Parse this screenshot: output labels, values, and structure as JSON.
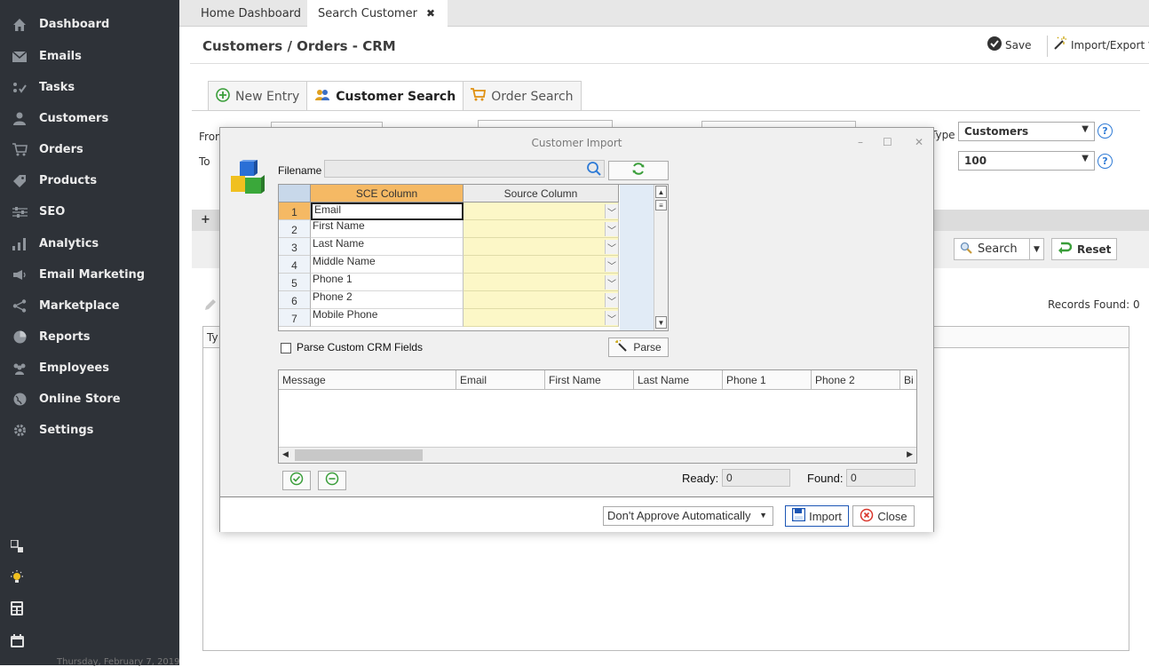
{
  "sidebar": {
    "items": [
      {
        "label": "Dashboard",
        "icon": "home-icon"
      },
      {
        "label": "Emails",
        "icon": "envelope-icon"
      },
      {
        "label": "Tasks",
        "icon": "tasks-icon"
      },
      {
        "label": "Customers",
        "icon": "user-icon"
      },
      {
        "label": "Orders",
        "icon": "cart-icon"
      },
      {
        "label": "Products",
        "icon": "tag-icon"
      },
      {
        "label": "SEO",
        "icon": "sliders-icon"
      },
      {
        "label": "Analytics",
        "icon": "bar-chart-icon"
      },
      {
        "label": "Email Marketing",
        "icon": "megaphone-icon"
      },
      {
        "label": "Marketplace",
        "icon": "share-icon"
      },
      {
        "label": "Reports",
        "icon": "pie-icon"
      },
      {
        "label": "Employees",
        "icon": "people-icon"
      },
      {
        "label": "Online Store",
        "icon": "globe-icon"
      },
      {
        "label": "Settings",
        "icon": "gear-icon"
      }
    ],
    "footer_date": "Thursday, February 7, 2019"
  },
  "tabs": {
    "home": "Home Dashboard",
    "search_customer": "Search Customer",
    "close_glyph": "✖"
  },
  "header": {
    "title": "Customers / Orders - CRM",
    "save": "Save",
    "import_export": "Import/Export"
  },
  "subtabs": {
    "new_entry": "New Entry",
    "customer_search": "Customer Search",
    "order_search": "Order Search"
  },
  "form": {
    "from_label": "From",
    "to_label": "To",
    "type_label": "Type",
    "type_value": "Customers",
    "limit_value": "100",
    "add_label": "+"
  },
  "toolbar": {
    "search": "Search",
    "reset": "Reset",
    "records_found": "Records Found: 0",
    "results_col_type": "Ty"
  },
  "modal": {
    "title": "Customer Import",
    "filename_label": "Filename",
    "grid_headers": {
      "sce": "SCE Column",
      "source": "Source Column"
    },
    "rows": [
      {
        "num": "1",
        "name": "Email"
      },
      {
        "num": "2",
        "name": "First Name"
      },
      {
        "num": "3",
        "name": "Last Name"
      },
      {
        "num": "4",
        "name": "Middle Name"
      },
      {
        "num": "5",
        "name": "Phone 1"
      },
      {
        "num": "6",
        "name": "Phone 2"
      },
      {
        "num": "7",
        "name": "Mobile Phone"
      }
    ],
    "parse_custom": "Parse Custom CRM Fields",
    "parse_button": "Parse",
    "log_headers": [
      "Message",
      "Email",
      "First Name",
      "Last Name",
      "Phone 1",
      "Phone 2",
      "Bi"
    ],
    "ready_label": "Ready:",
    "ready_value": "0",
    "found_label": "Found:",
    "found_value": "0",
    "approve_option": "Don't Approve Automatically",
    "import_button": "Import",
    "close_button": "Close"
  },
  "colors": {
    "sidebar_bg": "#2e3238",
    "grid_header": "#f5b964",
    "source_cell": "#fcf7c7",
    "accent_green": "#3a9e3a",
    "accent_blue": "#2f7bd6",
    "close_red": "#d9362c"
  }
}
